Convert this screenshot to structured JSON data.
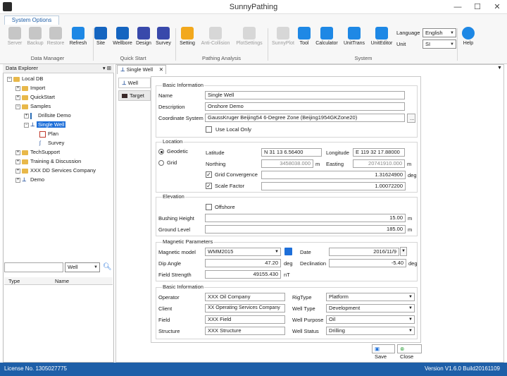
{
  "app": {
    "title": "SunnyPathing"
  },
  "ribbon": {
    "tab": "System Options",
    "buttons": [
      {
        "label": "Server",
        "color": "#8a8a8a"
      },
      {
        "label": "Backup",
        "color": "#8a8a8a"
      },
      {
        "label": "Restore",
        "color": "#8a8a8a"
      },
      {
        "label": "Refresh",
        "color": "#1e88e5"
      },
      {
        "label": "Site",
        "color": "#1565c0"
      },
      {
        "label": "Wellbore",
        "color": "#1565c0"
      },
      {
        "label": "Design",
        "color": "#3949ab"
      },
      {
        "label": "Survey",
        "color": "#3949ab"
      },
      {
        "label": "Setting",
        "color": "#f2a81d"
      },
      {
        "label": "Anti-Collision",
        "color": "#b0b0b0"
      },
      {
        "label": "PlotSettings",
        "color": "#b0b0b0"
      },
      {
        "label": "SunnyPlot",
        "color": "#b0b0b0"
      },
      {
        "label": "Tool",
        "color": "#1e88e5"
      },
      {
        "label": "Calculator",
        "color": "#1e88e5"
      },
      {
        "label": "UnitTrans",
        "color": "#1e88e5"
      },
      {
        "label": "UnitEditor",
        "color": "#1e88e5"
      },
      {
        "label": "Help",
        "color": "#1e88e5"
      }
    ],
    "groups": [
      "Data Manager",
      "Quick Start",
      "Pathing Analysis",
      "System"
    ],
    "language_label": "Language",
    "language_value": "English",
    "unit_label": "Unit",
    "unit_value": "SI"
  },
  "explorer": {
    "title": "Data Explorer",
    "pin": "▾ ⊞",
    "tree": {
      "root": "Local DB",
      "import": "Import",
      "quickstart": "QuickStart",
      "samples": "Samples",
      "drillsite": "Drillsite Demo",
      "singlewell": "Single Well",
      "plan": "Plan",
      "survey": "Survey",
      "techsupport": "TechSupport",
      "training": "Training & Discussion",
      "xxx": "XXX DD Services Company",
      "demo": "Demo"
    },
    "filter_value": "Well",
    "grid_headers": [
      "Type",
      "Name"
    ]
  },
  "document": {
    "tab_label": "Single Well",
    "side_tabs": [
      "Well",
      "Target"
    ]
  },
  "form": {
    "basic": {
      "title": "Basic Information",
      "name_label": "Name",
      "name": "Single Well",
      "desc_label": "Description",
      "desc": "Onshore Demo",
      "coord_label": "Coordinate System",
      "coord": "GaussKruger Beijing54 6-Degree Zone    (Beijing1954GKZone20)",
      "browse": "...",
      "use_local": "Use Local Only"
    },
    "location": {
      "title": "Location",
      "geodetic": "Geodetic",
      "grid": "Grid",
      "lat_label": "Latitude",
      "lat": "N 31 13 6.56400",
      "lon_label": "Longitude",
      "lon": "E 119 32 17.88000",
      "north_label": "Northing",
      "north": "3458038.000",
      "north_unit": "m",
      "east_label": "Easting",
      "east": "20741910.000",
      "east_unit": "m",
      "conv_label": "Grid Convergence",
      "conv": "1.31624900",
      "conv_unit": "deg",
      "scale_label": "Scale Factor",
      "scale": "1.00072200"
    },
    "elevation": {
      "title": "Elevation",
      "offshore": "Offshore",
      "bushing_label": "Bushing Height",
      "bushing": "15.00",
      "bushing_unit": "m",
      "ground_label": "Ground Level",
      "ground": "185.00",
      "ground_unit": "m"
    },
    "magnetic": {
      "title": "Magnetic Parameters",
      "model_label": "Magnetic model",
      "model": "WMM2015",
      "date_label": "Date",
      "date": "2016/11/9",
      "dip_label": "Dip Angle",
      "dip": "47.20",
      "dip_unit": "deg",
      "decl_label": "Declination",
      "decl": "-5.40",
      "decl_unit": "deg",
      "field_label": "Field Strength",
      "field": "49155.430",
      "field_unit": "nT"
    },
    "basic2": {
      "title": "Basic Information",
      "operator_label": "Operator",
      "operator": "XXX Oil Company",
      "client_label": "Client",
      "client": "XX Operating Services Company",
      "field_label": "Field",
      "field": "XXX Field",
      "structure_label": "Structure",
      "structure": "XXX Structure",
      "rig_label": "RigType",
      "rig": "Platform",
      "welltype_label": "Well Type",
      "welltype": "Development",
      "purpose_label": "Well Purpose",
      "purpose": "Oil",
      "status_label": "Well Status",
      "status": "Drilling"
    },
    "save": "Save",
    "close": "Close"
  },
  "status": {
    "license": "License No. 1305027775",
    "version": "Version V1.6.0 Build20161109",
    "accent": "#1e5fa8"
  }
}
